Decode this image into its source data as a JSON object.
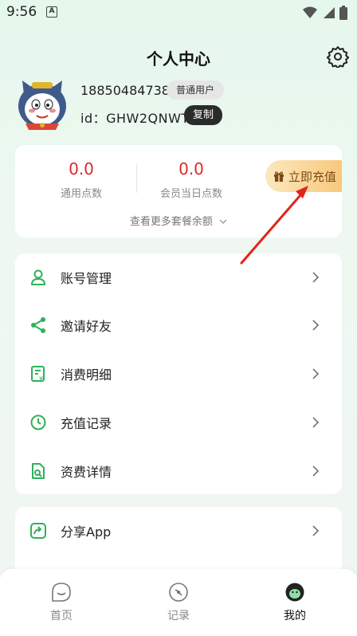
{
  "status": {
    "time": "9:56",
    "notification_glyph": "A"
  },
  "header": {
    "title": "个人中心"
  },
  "user": {
    "phone": "18850484738",
    "badge": "普通用户",
    "id_text": "id：GHW2QNWT",
    "copy_label": "复制"
  },
  "points": {
    "general_value": "0.0",
    "general_label": "通用点数",
    "daily_value": "0.0",
    "daily_label": "会员当日点数",
    "more_label": "查看更多套餐余额",
    "recharge_label": "立即充值"
  },
  "menu": [
    {
      "label": "账号管理",
      "icon": "user-icon"
    },
    {
      "label": "邀请好友",
      "icon": "share-nodes-icon"
    },
    {
      "label": "消费明细",
      "icon": "receipt-icon"
    },
    {
      "label": "充值记录",
      "icon": "clock-icon"
    },
    {
      "label": "资费详情",
      "icon": "doc-search-icon"
    }
  ],
  "share": {
    "label": "分享App",
    "icon": "share-arrow-icon"
  },
  "tabs": [
    {
      "label": "首页",
      "icon": "smile-bubble-icon"
    },
    {
      "label": "记录",
      "icon": "record-icon"
    },
    {
      "label": "我的",
      "icon": "profile-face-icon",
      "active": true
    }
  ],
  "colors": {
    "accent": "#2fb15a",
    "points": "#e0262b",
    "annotation": "#e2231a"
  }
}
